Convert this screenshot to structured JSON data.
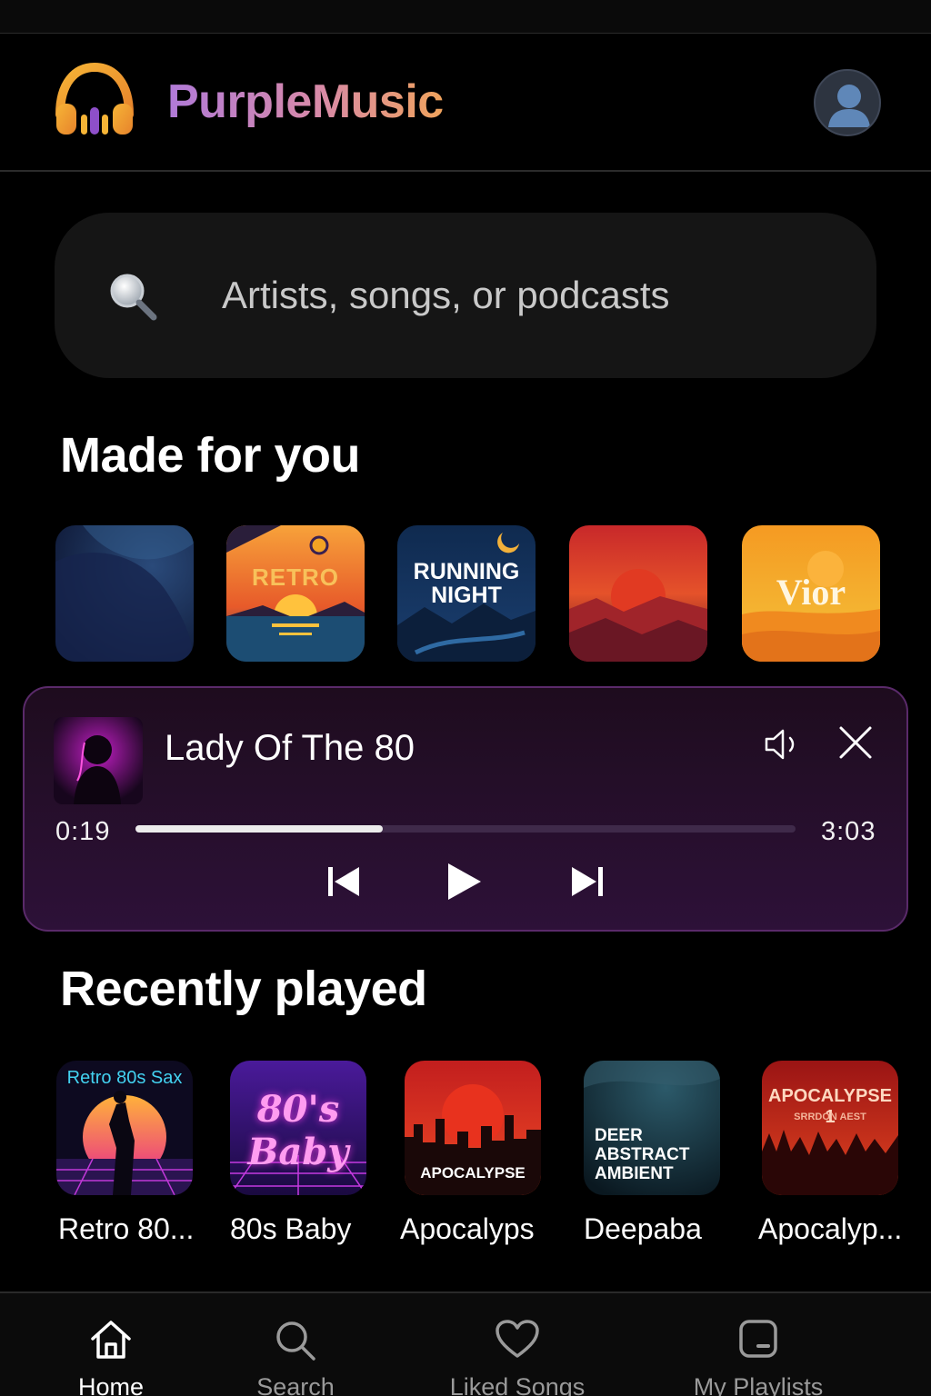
{
  "app": {
    "title": "PurpleMusic"
  },
  "search": {
    "placeholder": "Artists, songs, or podcasts"
  },
  "made_for_you": {
    "title": "Made for you",
    "tiles": [
      {
        "text": ""
      },
      {
        "text": "RETRO"
      },
      {
        "text_line1": "RUNNING",
        "text_line2": "NIGHT"
      },
      {
        "text": ""
      },
      {
        "text": "Vior"
      }
    ]
  },
  "player": {
    "track_title": "Lady Of The 80",
    "elapsed": "0:19",
    "total": "3:03",
    "progress": 0.375
  },
  "recently_played": {
    "title": "Recently played",
    "items": [
      {
        "label": "Retro 80...",
        "art_text": "Retro 80s Sax"
      },
      {
        "label": "80s Baby",
        "art_text": "80's Baby"
      },
      {
        "label": "Apocalyps",
        "art_text": "APOCALYPSE"
      },
      {
        "label": "Deepaba",
        "art_line1": "DEER",
        "art_line2": "ABSTRACT",
        "art_line3": "AMBIENT"
      },
      {
        "label": "Apocalyp...",
        "art_text": "APOCALYPSE 1",
        "art_sub": "SRRDON AEST"
      }
    ]
  },
  "nav": {
    "items": [
      {
        "label": "Home",
        "icon": "home-icon",
        "active": true
      },
      {
        "label": "Search",
        "icon": "search-icon"
      },
      {
        "label": "Liked Songs",
        "icon": "heart-icon"
      },
      {
        "label": "My Playlists",
        "icon": "playlist-icon"
      }
    ]
  },
  "colors": {
    "background": "#000000",
    "accent_purple": "#b07ad8",
    "accent_orange": "#f0a35c",
    "player_bg": "#2d1138"
  }
}
